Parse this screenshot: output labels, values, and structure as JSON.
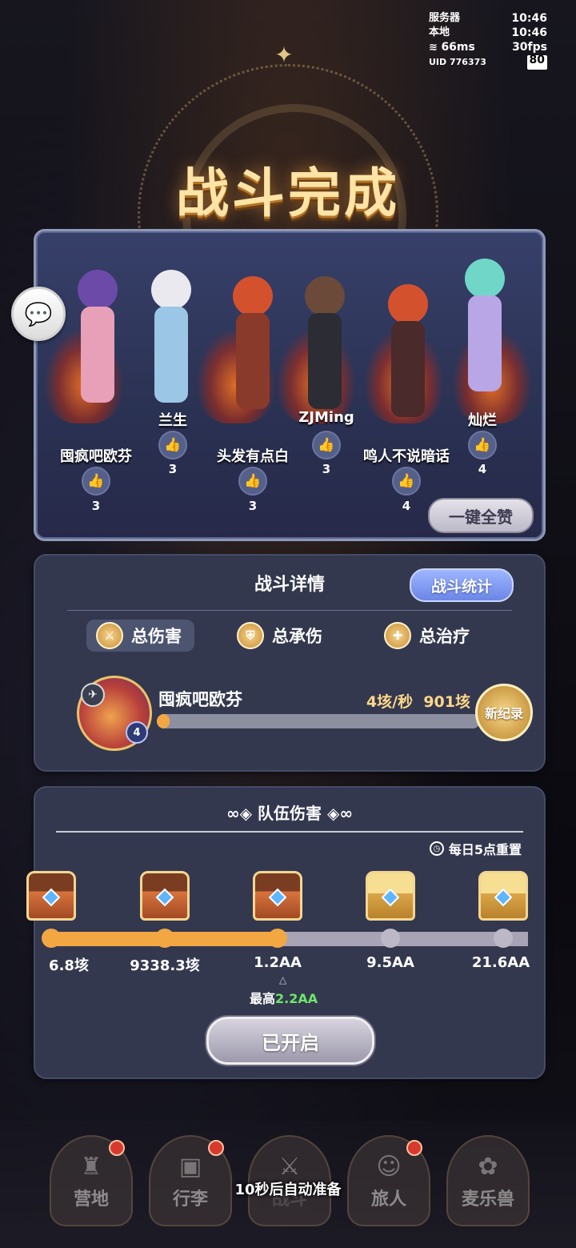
{
  "status": {
    "server_label": "服务器",
    "server_time": "10:46",
    "local_label": "本地",
    "local_time": "10:46",
    "ping": "66ms",
    "fps": "30fps",
    "uid": "UID 776373",
    "battery": "80"
  },
  "title": "战斗完成",
  "team": [
    {
      "name": "囤疯吧欧芬",
      "likes": "3"
    },
    {
      "name": "兰生",
      "likes": "3"
    },
    {
      "name": "头发有点白",
      "likes": "3"
    },
    {
      "name": "ZJMing",
      "likes": "3"
    },
    {
      "name": "鸣人不说暗话",
      "likes": "4"
    },
    {
      "name": "灿烂",
      "likes": "4"
    }
  ],
  "like_all_label": "一键全赞",
  "battle_details": {
    "heading": "战斗详情",
    "stats_button": "战斗统计",
    "tabs": [
      {
        "label": "总伤害",
        "icon": "sword-icon",
        "active": true
      },
      {
        "label": "总承伤",
        "icon": "shield-icon",
        "active": false
      },
      {
        "label": "总治疗",
        "icon": "heal-icon",
        "active": false
      }
    ],
    "player": {
      "name": "囤疯吧欧芬",
      "level": "4",
      "dps": "4垓/秒",
      "total": "901垓",
      "progress": 0.03,
      "record_label": "新纪录"
    }
  },
  "team_damage": {
    "heading": "队伍伤害",
    "reset_note": "每日5点重置",
    "tiers": [
      {
        "value": "6.8垓",
        "chest": "copper",
        "reached": true
      },
      {
        "value": "9338.3垓",
        "chest": "copper",
        "reached": true
      },
      {
        "value": "1.2AA",
        "chest": "copper",
        "reached": true
      },
      {
        "value": "9.5AA",
        "chest": "gold",
        "reached": false
      },
      {
        "value": "21.6AA",
        "chest": "gold",
        "reached": false
      }
    ],
    "best_label": "最高",
    "best_value": "2.2AA",
    "button": "已开启"
  },
  "nav": [
    {
      "label": "营地",
      "icon": "castle-icon",
      "badge": true
    },
    {
      "label": "行李",
      "icon": "bag-icon",
      "badge": true
    },
    {
      "label": "战斗",
      "icon": "crossed-swords-icon",
      "badge": false
    },
    {
      "label": "旅人",
      "icon": "traveler-icon",
      "badge": true
    },
    {
      "label": "麦乐兽",
      "icon": "pet-icon",
      "badge": false
    }
  ],
  "auto_ready": "10秒后自动准备"
}
